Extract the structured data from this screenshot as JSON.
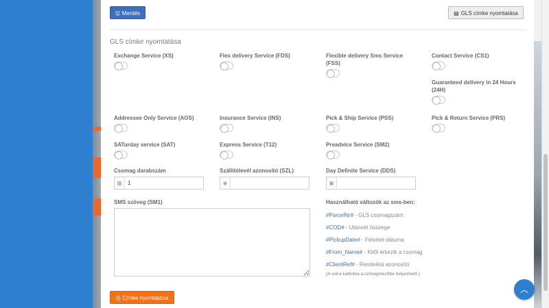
{
  "toolbar": {
    "save_label": "Mentés",
    "print_top_label": "GLS címke nyomtatása"
  },
  "section_title": "GLS címke nyomtatása",
  "options": [
    {
      "label": "Exchange Service (XS)"
    },
    {
      "label": "Flex delivery Service (FDS)"
    },
    {
      "label": "Flexible delivery Sms Service (FSS)"
    },
    {
      "label": "Contact Service (CS1)"
    },
    {
      "label": "Guaranteed delivery in 24 Hours (24H)"
    },
    {
      "label": "Addressee Only Service (AOS)"
    },
    {
      "label": "Insurance Service (INS)"
    },
    {
      "label": "Pick & Ship Service (PSS)"
    },
    {
      "label": "Pick & Return Service (PRS)"
    },
    {
      "label": "SATurday service (SAT)"
    },
    {
      "label": "Express Service (T12)"
    },
    {
      "label": "Preadvice Service (SM2)"
    }
  ],
  "fields": {
    "package_count": {
      "label": "Csomag darabszám",
      "value": "1"
    },
    "delivery_note": {
      "label": "Szállítólevél azonosító (SZL)",
      "value": ""
    },
    "day_definite": {
      "label": "Day Definite Service (DDS)",
      "value": ""
    },
    "sms_text": {
      "label": "SMS szöveg (SM1)",
      "value": ""
    }
  },
  "variables": {
    "title": "Használható változók az sms-ben:",
    "items": [
      {
        "code": "#ParcelNr#",
        "desc": " - GLS csomagszám"
      },
      {
        "code": "#COD#",
        "desc": " - Utánvét összege"
      },
      {
        "code": "#PickupDate#",
        "desc": " - Felvétel dátuma"
      },
      {
        "code": "#From_Name#",
        "desc": " - Kitől érkezik a csomag"
      },
      {
        "code": "#ClientRef#",
        "desc": " - Rendelési azonosító"
      }
    ],
    "note": "(A sorra kattintva a szövegmezőbe helyezhető.)"
  },
  "bottom": {
    "print_label": "Címke nyomtatása"
  },
  "icons": {
    "save": "floppy-icon",
    "print_doc": "file-icon",
    "print": "printer-icon",
    "calc": "calculator-icon",
    "tag": "tag-icon",
    "calendar": "calendar-icon",
    "up": "chevron-up-icon"
  },
  "colors": {
    "sidebar": "#2e7fd0",
    "primary": "#3d6fbd",
    "warning": "#f0731c"
  }
}
